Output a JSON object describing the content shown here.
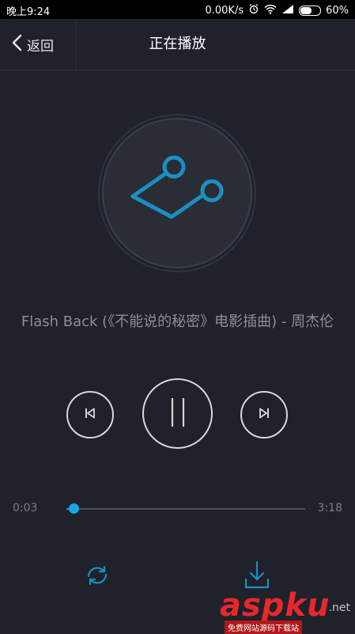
{
  "status_bar": {
    "time": "晚上9:24",
    "network_speed": "0.00K/s",
    "battery_percent": "60%",
    "battery_level": 0.6,
    "icons": [
      "alarm-icon",
      "wifi-icon",
      "signal-icon",
      "battery-icon"
    ]
  },
  "nav": {
    "back_label": "返回",
    "title": "正在播放"
  },
  "player": {
    "song_title": "Flash Back (《不能说的秘密》电影插曲) - 周杰伦",
    "current_time": "0:03",
    "total_time": "3:18",
    "progress": 0.03,
    "state": "playing"
  },
  "watermark": {
    "brand": "aspku",
    "tld": ".net",
    "tagline": "免费网站源码下载站"
  },
  "colors": {
    "background": "#1f222a",
    "accent": "#1aa6e4",
    "logo_blue": "#1b8fc2",
    "text_muted": "#8c8f96"
  }
}
